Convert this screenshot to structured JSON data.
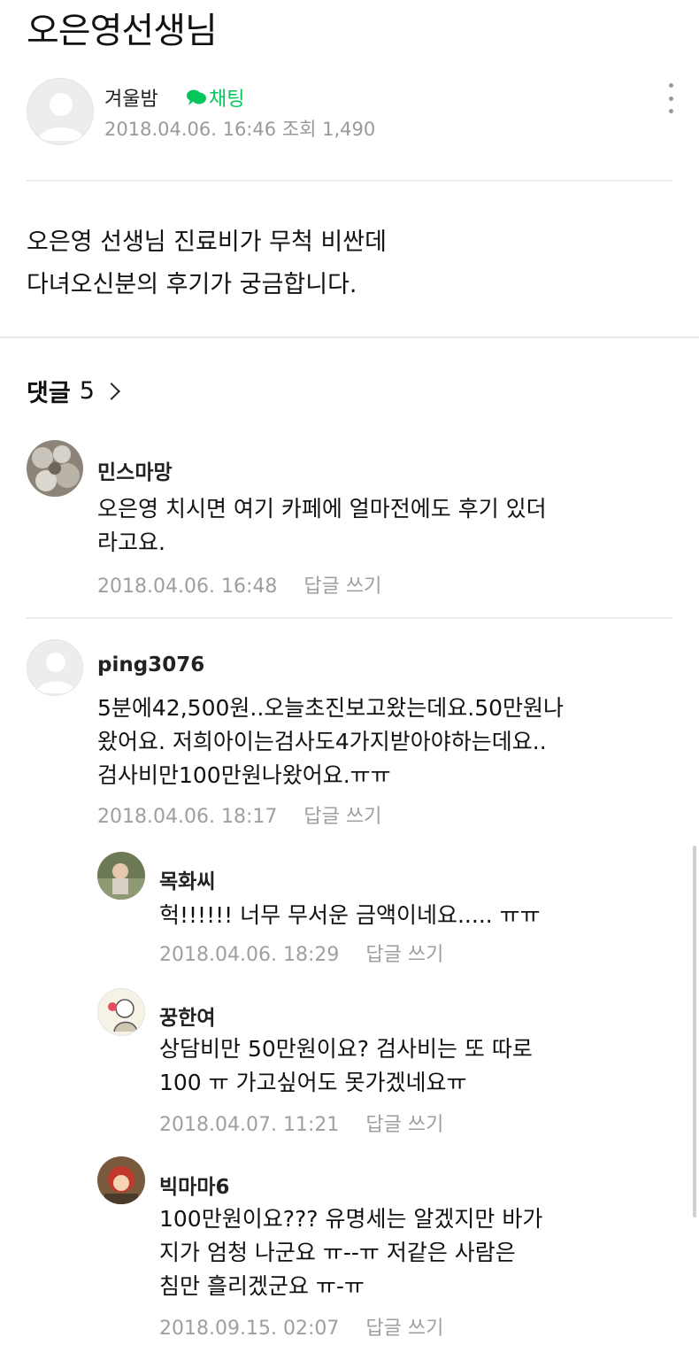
{
  "post": {
    "title": "오은영선생님",
    "author": "겨울밤",
    "chat_label": "채팅",
    "date": "2018.04.06. 16:46",
    "views": "조회 1,490",
    "body": [
      "오은영 선생님 진료비가 무척 비싼데",
      "다녀오신분의 후기가 궁금합니다."
    ]
  },
  "comments_header": {
    "label": "댓글",
    "count": "5"
  },
  "comments": [
    {
      "name": "민스마망",
      "lines": [
        "오은영 치시면 여기 카페에 얼마전에도 후기 있더",
        "라고요."
      ],
      "date": "2018.04.06. 16:48",
      "reply": "답글 쓰기"
    },
    {
      "name": "ping3076",
      "lines": [
        "5분에42,500원..오늘초진보고왔는데요.50만원나",
        "왔어요. 저희아이는검사도4가지받아야하는데요..",
        "검사비만100만원나왔어요.ㅠㅠ"
      ],
      "date": "2018.04.06. 18:17",
      "reply": "답글 쓰기"
    }
  ],
  "replies": [
    {
      "name": "목화씨",
      "lines": [
        "헉!!!!!! 너무 무서운 금액이네요..... ㅠㅠ"
      ],
      "date": "2018.04.06. 18:29",
      "reply": "답글 쓰기"
    },
    {
      "name": "꿍한여",
      "lines": [
        "상담비만 50만원이요? 검사비는 또 따로",
        "100 ㅠ 가고싶어도 못가겠네요ㅠ"
      ],
      "date": "2018.04.07. 11:21",
      "reply": "답글 쓰기"
    },
    {
      "name": "빅마마6",
      "lines": [
        "100만원이요??? 유명세는 알겠지만 바가",
        "지가 엄청 나군요 ㅠ--ㅠ 저같은 사람은",
        "침만 흘리겠군요 ㅠ-ㅠ"
      ],
      "date": "2018.09.15. 02:07",
      "reply": "답글 쓰기"
    }
  ],
  "colors": {
    "accent": "#03c75a",
    "meta": "#9a9a9a"
  },
  "icons": [
    "more-vertical-icon",
    "chat-bubble-icon",
    "chevron-right-icon",
    "default-avatar-icon"
  ]
}
